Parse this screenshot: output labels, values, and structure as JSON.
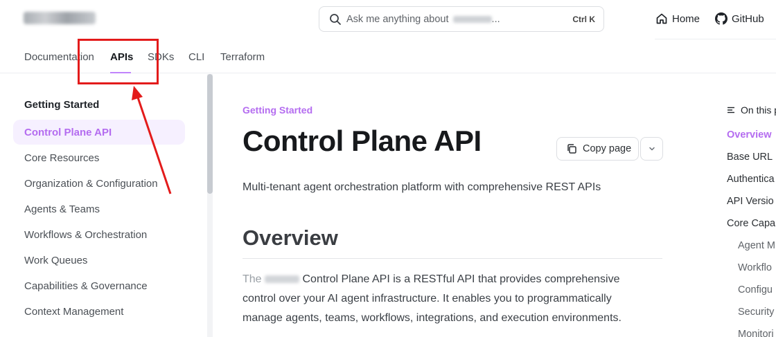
{
  "header": {
    "search_placeholder_prefix": "Ask me anything about",
    "search_placeholder_suffix": "...",
    "search_shortcut": "Ctrl K",
    "home_label": "Home",
    "github_label": "GitHub"
  },
  "tabs": [
    {
      "label": "Documentation"
    },
    {
      "label": "APIs"
    },
    {
      "label": "SDKs"
    },
    {
      "label": "CLI"
    },
    {
      "label": "Terraform"
    }
  ],
  "sidebar": {
    "heading": "Getting Started",
    "items": [
      {
        "label": "Control Plane API"
      },
      {
        "label": "Core Resources"
      },
      {
        "label": "Organization & Configuration"
      },
      {
        "label": "Agents & Teams"
      },
      {
        "label": "Workflows & Orchestration"
      },
      {
        "label": "Work Queues"
      },
      {
        "label": "Capabilities & Governance"
      },
      {
        "label": "Context Management"
      }
    ]
  },
  "main": {
    "eyebrow": "Getting Started",
    "title": "Control Plane API",
    "copy_label": "Copy page",
    "description": "Multi-tenant agent orchestration platform with comprehensive REST APIs",
    "section_heading": "Overview",
    "para_start": "The",
    "para_line1_rest": "Control Plane API is a RESTful API that provides comprehensive",
    "para_line2": "control over your AI agent infrastructure. It enables you to programmatically",
    "para_line3": "manage agents, teams, workflows, integrations, and execution environments."
  },
  "toc": {
    "heading": "On this p",
    "items": [
      {
        "label": "Overview"
      },
      {
        "label": "Base URL"
      },
      {
        "label": "Authentica"
      },
      {
        "label": "API Versio"
      },
      {
        "label": "Core Capal"
      },
      {
        "label": "Agent M"
      },
      {
        "label": "Workflo"
      },
      {
        "label": "Configu"
      },
      {
        "label": "Security"
      },
      {
        "label": "Monitori"
      }
    ]
  },
  "colors": {
    "accent": "#b46cf0",
    "annotation": "#e31b1b"
  }
}
